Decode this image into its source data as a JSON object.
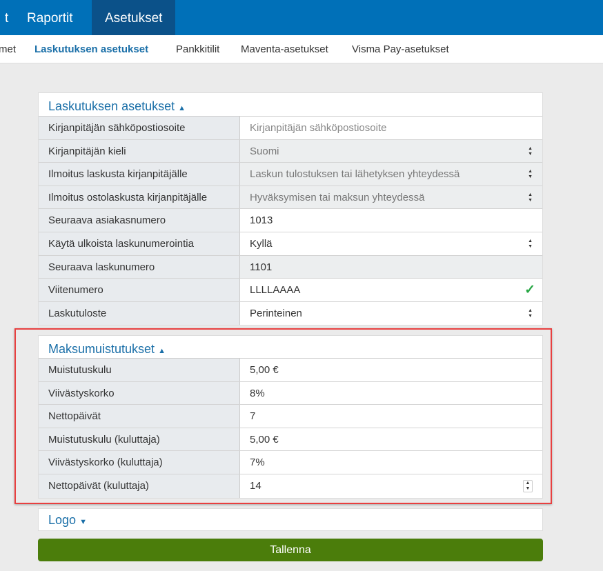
{
  "topnav": {
    "items": [
      "t",
      "Raportit",
      "Asetukset"
    ],
    "active": "Asetukset"
  },
  "subnav": {
    "items": [
      "met",
      "Laskutuksen asetukset",
      "Pankkitilit",
      "Maventa-asetukset",
      "Visma Pay-asetukset"
    ]
  },
  "billing": {
    "title": "Laskutuksen asetukset",
    "caret": "▲",
    "rows": [
      {
        "label": "Kirjanpitäjän sähköpostiosoite",
        "value": "Kirjanpitäjän sähköpostiosoite"
      },
      {
        "label": "Kirjanpitäjän kieli",
        "value": "Suomi"
      },
      {
        "label": "Ilmoitus laskusta kirjanpitäjälle",
        "value": "Laskun tulostuksen tai lähetyksen yhteydessä"
      },
      {
        "label": "Ilmoitus ostolaskusta kirjanpitäjälle",
        "value": "Hyväksymisen tai maksun yhteydessä"
      },
      {
        "label": "Seuraava asiakasnumero",
        "value": "1013"
      },
      {
        "label": "Käytä ulkoista laskunumerointia",
        "value": "Kyllä"
      },
      {
        "label": "Seuraava laskunumero",
        "value": "1101"
      },
      {
        "label": "Viitenumero",
        "value": "LLLLAAAA"
      },
      {
        "label": "Laskutuloste",
        "value": "Perinteinen"
      }
    ]
  },
  "reminders": {
    "title": "Maksumuistutukset",
    "caret": "▲",
    "rows": [
      {
        "label": "Muistutuskulu",
        "value": "5,00 €"
      },
      {
        "label": "Viivästyskorko",
        "value": "8%"
      },
      {
        "label": "Nettopäivät",
        "value": "7"
      },
      {
        "label": "Muistutuskulu (kuluttaja)",
        "value": "5,00 €"
      },
      {
        "label": "Viivästyskorko (kuluttaja)",
        "value": "7%"
      },
      {
        "label": "Nettopäivät (kuluttaja)",
        "value": "14"
      }
    ]
  },
  "logo": {
    "title": "Logo",
    "caret": "▼"
  },
  "save_label": "Tallenna",
  "colors": {
    "primary": "#0070b8",
    "save": "#4b7d0b",
    "highlight": "#e84040"
  }
}
